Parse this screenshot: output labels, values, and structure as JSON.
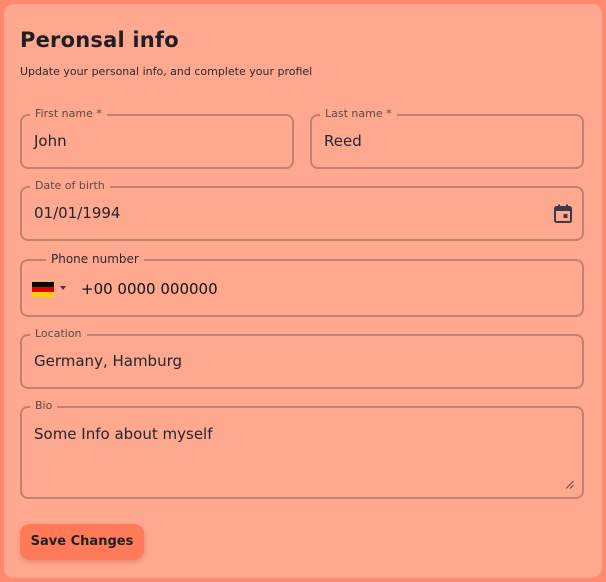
{
  "header": {
    "title": "Peronsal info",
    "subtitle": "Update your personal info, and complete your profiel"
  },
  "form": {
    "first_name": {
      "label": "First name *",
      "value": "John"
    },
    "last_name": {
      "label": "Last name *",
      "value": "Reed"
    },
    "date_of_birth": {
      "label": "Date of birth",
      "value": "01/01/1994",
      "icon": "calendar-icon"
    },
    "phone": {
      "label": "Phone number",
      "value": "+00 0000 000000",
      "country_flag": "germany-flag-icon"
    },
    "location": {
      "label": "Location",
      "value": "Germany, Hamburg"
    },
    "bio": {
      "label": "Bio",
      "value": "Some Info about myself"
    }
  },
  "actions": {
    "save_label": "Save Changes"
  },
  "colors": {
    "background": "#ff8a6e",
    "card": "#ffa890",
    "field_border": "#c0826f",
    "button": "#ff7a58",
    "text": "#1f1f27"
  }
}
